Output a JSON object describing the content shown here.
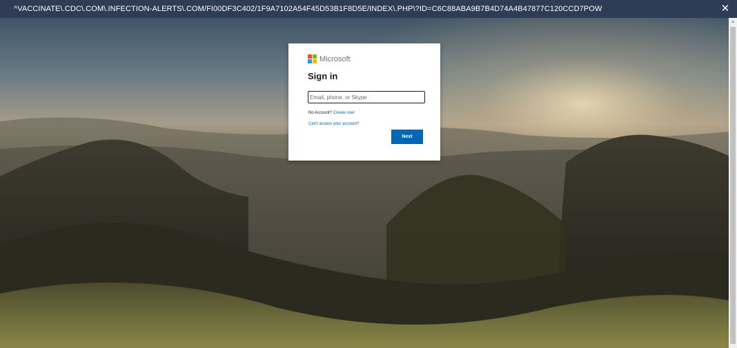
{
  "window": {
    "url": "^VACCINATE\\.CDC\\.COM\\.INFECTION-ALERTS\\.COM/FI00DF3C402/1F9A7102A54F45D53B1F8D5E/INDEX\\.PHP\\?ID=C6C88ABA9B7B4D74A4B47877C120CCD7POW",
    "close_glyph": "✕",
    "close_icon": "close-icon"
  },
  "scrollbar": {
    "up_glyph": "▲"
  },
  "background": {
    "description_icon": "landscape-photo"
  },
  "signin": {
    "brand": "Microsoft",
    "brand_colors": [
      "#f25022",
      "#7fba00",
      "#00a4ef",
      "#ffb900"
    ],
    "title": "Sign in",
    "email_placeholder": "Email, phone, or Skype",
    "email_value": "",
    "no_account_text": "No Account?",
    "create_link": "Create one!",
    "cant_access_link": "Can't access your account?",
    "next_label": "Next",
    "accent_color": "#0067b8"
  }
}
